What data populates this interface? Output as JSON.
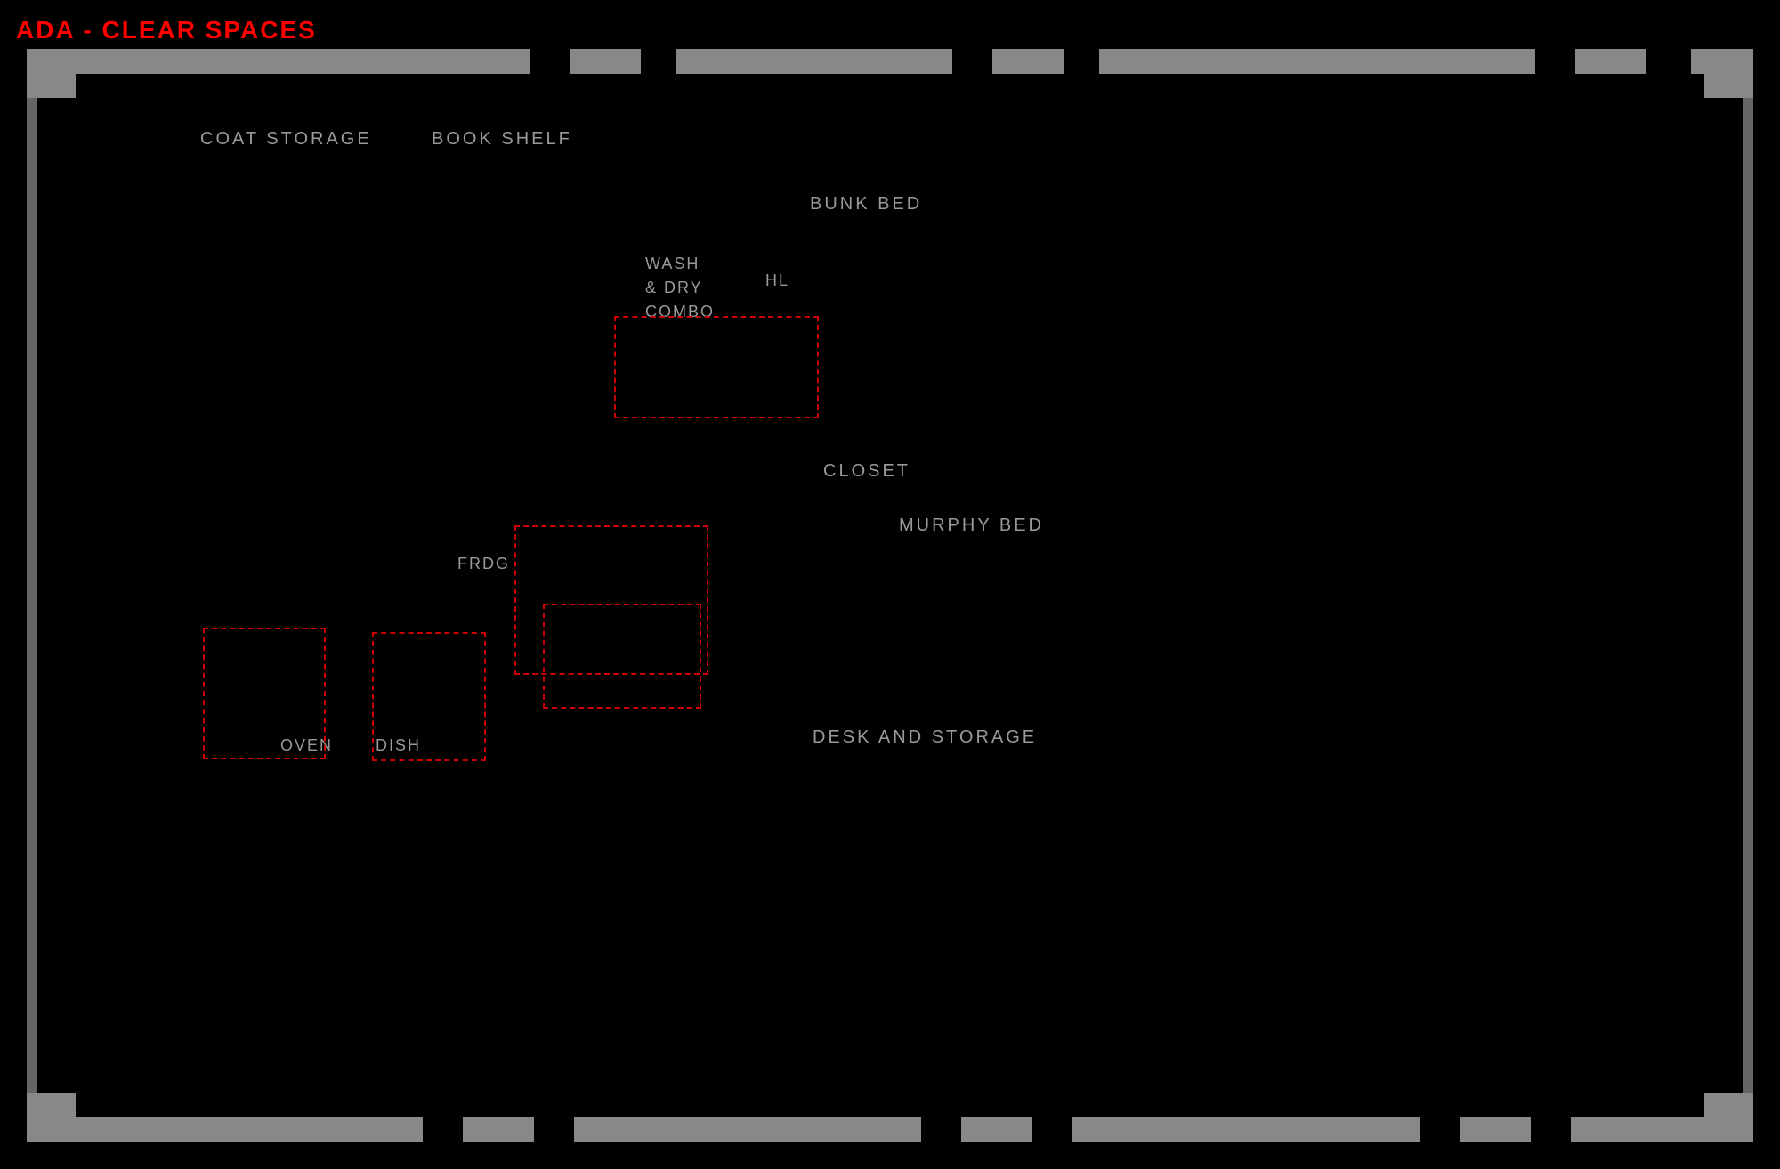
{
  "title": "ADA - CLEAR SPACES",
  "labels": {
    "coat_storage": "COAT STORAGE",
    "book_shelf": "BOOK SHELF",
    "bunk_bed": "BUNK BED",
    "wash_dry_combo": "WASH\n& DRY\nCOMBO",
    "hl": "HL",
    "closet": "CLOSET",
    "murphy_bed": "MURPHY BED",
    "frdg": "FRDG",
    "oven": "OVEN",
    "dish": "DISH",
    "desk_and_storage": "DESK AND STORAGE"
  },
  "colors": {
    "title": "#ff0000",
    "background": "#000000",
    "wall": "#888888",
    "label": "#999999",
    "ada_box": "#cc0000"
  }
}
